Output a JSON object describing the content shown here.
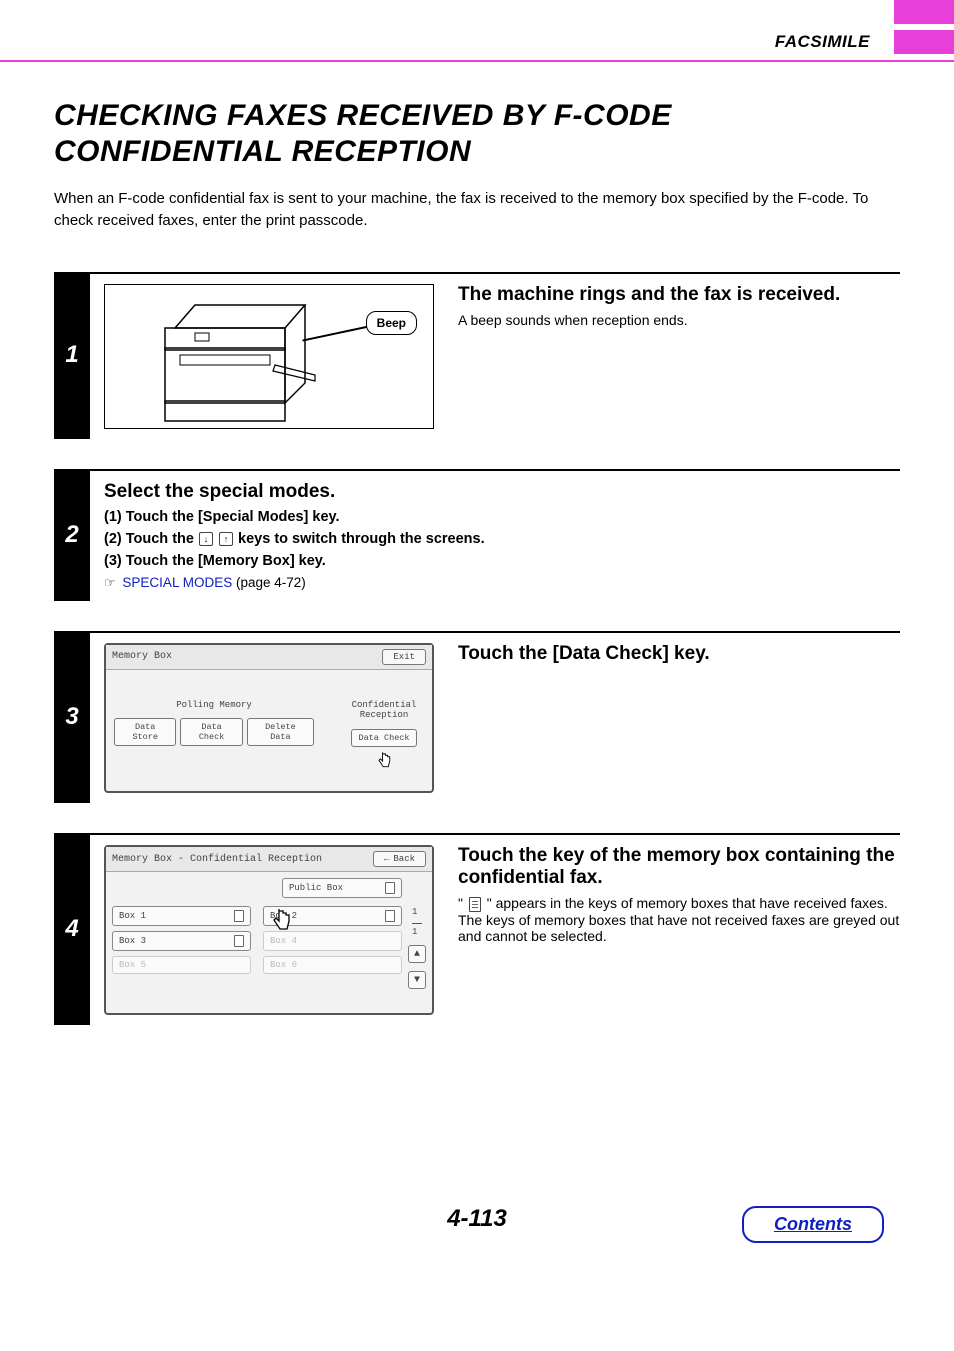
{
  "header": {
    "section_label": "FACSIMILE"
  },
  "title": "CHECKING FAXES RECEIVED BY F-CODE CONFIDENTIAL RECEPTION",
  "intro": "When an F-code confidential fax is sent to your machine, the fax is received to the memory box specified by the F-code. To check received faxes, enter the print passcode.",
  "steps": {
    "s1": {
      "num": "1",
      "beep_label": "Beep",
      "heading": "The machine rings and the fax is received.",
      "sub": "A beep sounds when reception ends."
    },
    "s2": {
      "num": "2",
      "heading": "Select the special modes.",
      "sub1": "(1)   Touch the [Special Modes] key.",
      "sub2_a": "(2)   Touch the ",
      "sub2_b": " keys to switch through the screens.",
      "sub3": "(3)   Touch the [Memory Box] key.",
      "ref_link": "SPECIAL MODES",
      "ref_page": " (page 4-72)"
    },
    "s3": {
      "num": "3",
      "heading": "Touch the [Data Check] key.",
      "panel": {
        "title": "Memory Box",
        "exit": "Exit",
        "col1_label": "Polling Memory",
        "col2_label": "Confidential Reception",
        "btn_store": "Data Store",
        "btn_check": "Data Check",
        "btn_delete": "Delete Data",
        "btn_check2": "Data Check"
      }
    },
    "s4": {
      "num": "4",
      "heading": "Touch the key of the memory box containing the confidential fax.",
      "body_a": "\" ",
      "body_b": " \" appears in the keys of memory boxes that have received faxes. The keys of memory boxes that have not received faxes are greyed out and cannot be selected.",
      "panel": {
        "title": "Memory Box - Confidential Reception",
        "back": "Back",
        "public": "Public Box",
        "boxes": [
          "Box 1",
          "Box 2",
          "Box 3",
          "Box 4",
          "Box 5",
          "Box 6"
        ],
        "page_cur": "1",
        "page_tot": "1"
      }
    }
  },
  "footer": {
    "page": "4-113",
    "contents": "Contents"
  }
}
